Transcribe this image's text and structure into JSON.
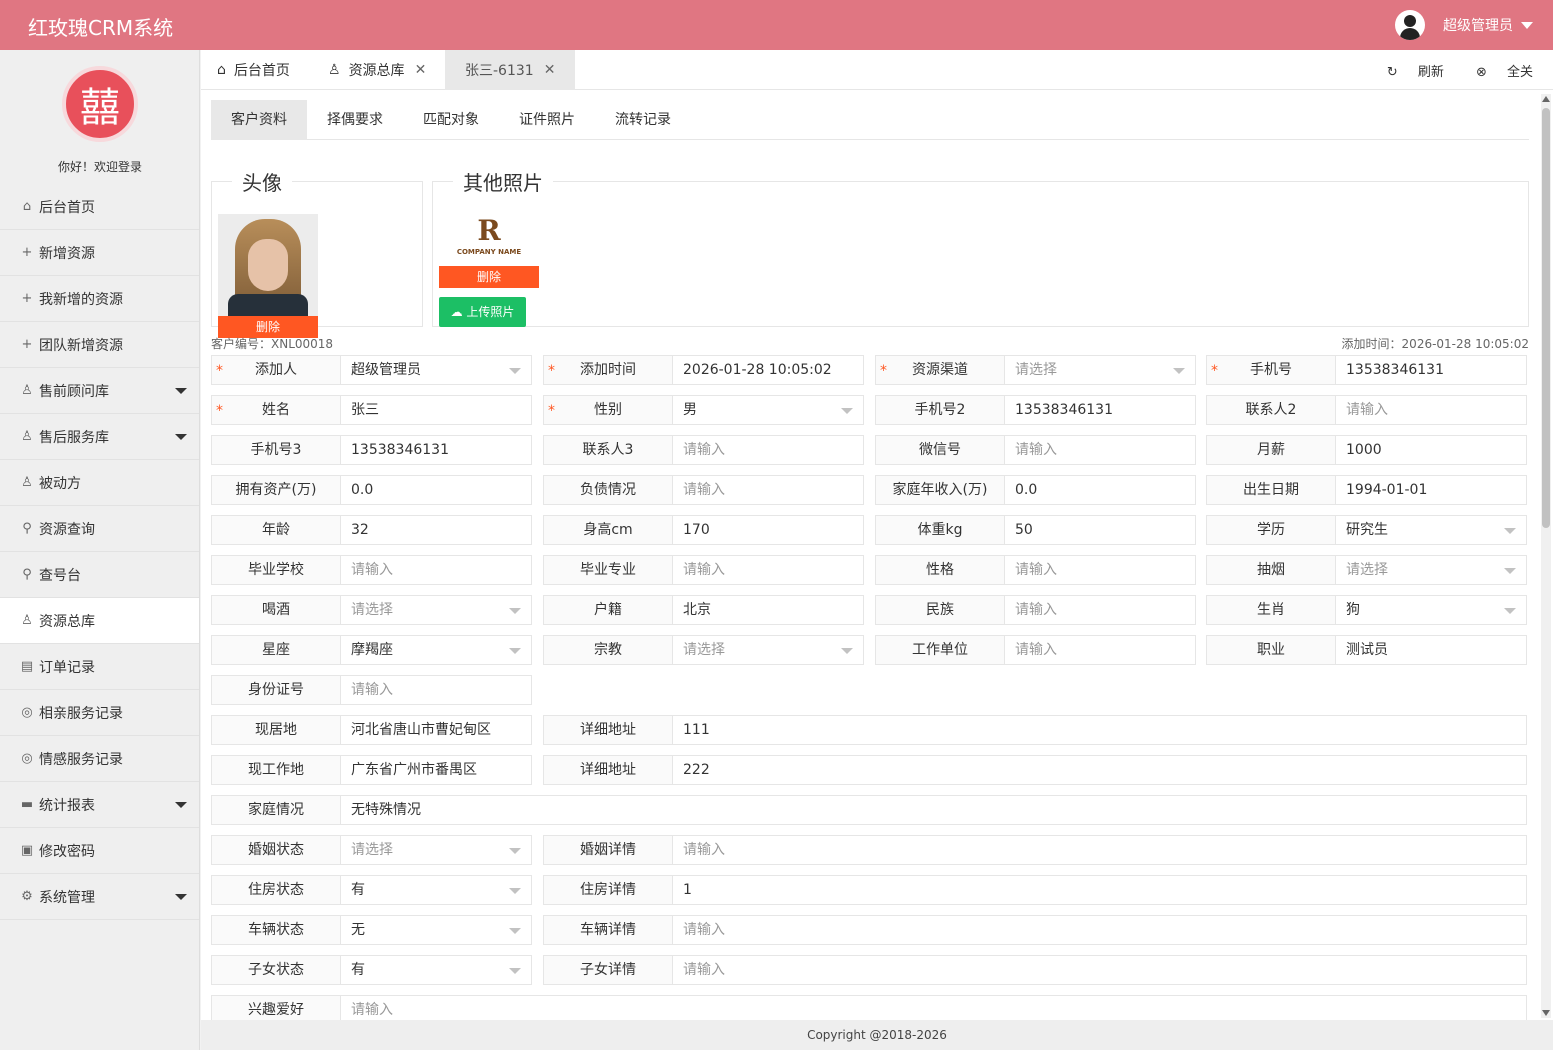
{
  "header": {
    "app_title": "红玫瑰CRM系统",
    "user_name": "超级管理员"
  },
  "sidebar": {
    "welcome": "你好！欢迎登录",
    "logo_glyph": "囍",
    "items": [
      {
        "label": "后台首页",
        "icon": "home-icon"
      },
      {
        "label": "新增资源",
        "icon": "plus-icon"
      },
      {
        "label": "我新增的资源",
        "icon": "plus-icon"
      },
      {
        "label": "团队新增资源",
        "icon": "plus-icon"
      },
      {
        "label": "售前顾问库",
        "icon": "user-icon"
      },
      {
        "label": "售后服务库",
        "icon": "user-icon"
      },
      {
        "label": "被动方",
        "icon": "user-icon"
      },
      {
        "label": "资源查询",
        "icon": "search-icon"
      },
      {
        "label": "查号台",
        "icon": "search-icon"
      },
      {
        "label": "资源总库",
        "icon": "user-icon"
      },
      {
        "label": "订单记录",
        "icon": "document-icon"
      },
      {
        "label": "相亲服务记录",
        "icon": "chat-icon"
      },
      {
        "label": "情感服务记录",
        "icon": "chat-icon"
      },
      {
        "label": "统计报表",
        "icon": "monitor-icon"
      },
      {
        "label": "修改密码",
        "icon": "lock-icon"
      },
      {
        "label": "系统管理",
        "icon": "gear-icon"
      }
    ]
  },
  "tabs": {
    "home": "后台首页",
    "resource_pool": "资源总库",
    "current": "张三-6131",
    "refresh": "刷新",
    "close_all": "全关"
  },
  "subtabs": [
    "客户资料",
    "择偶要求",
    "匹配对象",
    "证件照片",
    "流转记录"
  ],
  "avatar_section": {
    "legend": "头像",
    "delete": "删除"
  },
  "photos_section": {
    "legend": "其他照片",
    "delete": "删除",
    "upload": "上传照片",
    "logo_mark": "R",
    "logo_caption": "COMPANY NAME"
  },
  "customer": {
    "id_text": "客户编号：XNL00018",
    "add_time_text": "添加时间：2026-01-28 10:05:02"
  },
  "fields": {
    "adder": {
      "label": "添加人",
      "value": "超级管理员"
    },
    "add_time": {
      "label": "添加时间",
      "value": "2026-01-28 10:05:02"
    },
    "channel": {
      "label": "资源渠道",
      "value": "请选择"
    },
    "mobile": {
      "label": "手机号",
      "value": "13538346131"
    },
    "name": {
      "label": "姓名",
      "value": "张三"
    },
    "gender": {
      "label": "性别",
      "value": "男"
    },
    "mobile2": {
      "label": "手机号2",
      "value": "13538346131"
    },
    "contact2": {
      "label": "联系人2",
      "value": "请输入"
    },
    "mobile3": {
      "label": "手机号3",
      "value": "13538346131"
    },
    "contact3": {
      "label": "联系人3",
      "value": "请输入"
    },
    "wechat": {
      "label": "微信号",
      "value": "请输入"
    },
    "salary": {
      "label": "月薪",
      "value": "1000"
    },
    "assets": {
      "label": "拥有资产(万)",
      "value": "0.0"
    },
    "debt": {
      "label": "负债情况",
      "value": "请输入"
    },
    "family_income": {
      "label": "家庭年收入(万)",
      "value": "0.0"
    },
    "birthday": {
      "label": "出生日期",
      "value": "1994-01-01"
    },
    "age": {
      "label": "年龄",
      "value": "32"
    },
    "height": {
      "label": "身高cm",
      "value": "170"
    },
    "weight": {
      "label": "体重kg",
      "value": "50"
    },
    "education": {
      "label": "学历",
      "value": "研究生"
    },
    "school": {
      "label": "毕业学校",
      "value": "请输入"
    },
    "major": {
      "label": "毕业专业",
      "value": "请输入"
    },
    "personality": {
      "label": "性格",
      "value": "请输入"
    },
    "smoking": {
      "label": "抽烟",
      "value": "请选择"
    },
    "drinking": {
      "label": "喝酒",
      "value": "请选择"
    },
    "hukou": {
      "label": "户籍",
      "value": "北京"
    },
    "ethnicity": {
      "label": "民族",
      "value": "请输入"
    },
    "zodiac": {
      "label": "生肖",
      "value": "狗"
    },
    "constellation": {
      "label": "星座",
      "value": "摩羯座"
    },
    "religion": {
      "label": "宗教",
      "value": "请选择"
    },
    "employer": {
      "label": "工作单位",
      "value": "请输入"
    },
    "occupation": {
      "label": "职业",
      "value": "测试员"
    },
    "id_number": {
      "label": "身份证号",
      "value": "请输入"
    },
    "residence": {
      "label": "现居地",
      "value": "河北省唐山市曹妃甸区"
    },
    "residence_detail": {
      "label": "详细地址",
      "value": "111"
    },
    "workplace": {
      "label": "现工作地",
      "value": "广东省广州市番禺区"
    },
    "workplace_detail": {
      "label": "详细地址",
      "value": "222"
    },
    "family": {
      "label": "家庭情况",
      "value": "无特殊情况"
    },
    "marital": {
      "label": "婚姻状态",
      "value": "请选择"
    },
    "marital_detail": {
      "label": "婚姻详情",
      "value": "请输入"
    },
    "housing": {
      "label": "住房状态",
      "value": "有"
    },
    "housing_detail": {
      "label": "住房详情",
      "value": "1"
    },
    "car": {
      "label": "车辆状态",
      "value": "无"
    },
    "car_detail": {
      "label": "车辆详情",
      "value": "请输入"
    },
    "children": {
      "label": "子女状态",
      "value": "有"
    },
    "children_detail": {
      "label": "子女详情",
      "value": "请输入"
    },
    "hobby": {
      "label": "兴趣爱好",
      "value": "请输入"
    }
  },
  "footer": {
    "copyright": "Copyright @2018-2026"
  }
}
